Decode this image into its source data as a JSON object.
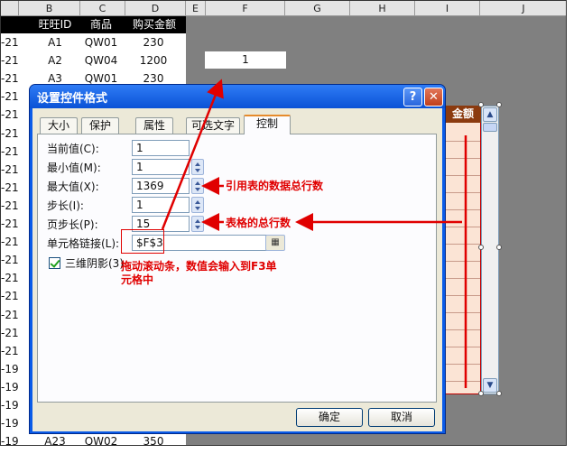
{
  "sheet": {
    "columns": [
      "B",
      "C",
      "D",
      "E",
      "F",
      "G",
      "H",
      "I",
      "J"
    ],
    "table_headers": [
      "旺旺ID",
      "商品",
      "购买金额"
    ],
    "rows": [
      {
        "a": "-21",
        "id": "A1",
        "item": "QW01",
        "amount": "230"
      },
      {
        "a": "-21",
        "id": "A2",
        "item": "QW04",
        "amount": "1200"
      },
      {
        "a": "-21",
        "id": "A3",
        "item": "QW01",
        "amount": "230"
      },
      {
        "a": "-21",
        "id": "",
        "item": "",
        "amount": ""
      },
      {
        "a": "-21",
        "id": "",
        "item": "",
        "amount": ""
      },
      {
        "a": "-21",
        "id": "",
        "item": "",
        "amount": ""
      },
      {
        "a": "-21",
        "id": "",
        "item": "",
        "amount": ""
      },
      {
        "a": "-21",
        "id": "",
        "item": "",
        "amount": ""
      },
      {
        "a": "-21",
        "id": "",
        "item": "",
        "amount": ""
      },
      {
        "a": "-21",
        "id": "",
        "item": "",
        "amount": ""
      },
      {
        "a": "-21",
        "id": "",
        "item": "",
        "amount": ""
      },
      {
        "a": "-21",
        "id": "",
        "item": "",
        "amount": ""
      },
      {
        "a": "-21",
        "id": "",
        "item": "",
        "amount": ""
      },
      {
        "a": "-21",
        "id": "",
        "item": "",
        "amount": ""
      },
      {
        "a": "-21",
        "id": "",
        "item": "",
        "amount": ""
      },
      {
        "a": "-21",
        "id": "",
        "item": "",
        "amount": ""
      },
      {
        "a": "-21",
        "id": "",
        "item": "",
        "amount": ""
      },
      {
        "a": "-21",
        "id": "",
        "item": "",
        "amount": ""
      },
      {
        "a": "-19",
        "id": "",
        "item": "",
        "amount": ""
      },
      {
        "a": "-19",
        "id": "",
        "item": "",
        "amount": ""
      },
      {
        "a": "-19",
        "id": "",
        "item": "",
        "amount": ""
      },
      {
        "a": "-19",
        "id": "",
        "item": "",
        "amount": ""
      },
      {
        "a": "-19",
        "id": "A23",
        "item": "QW02",
        "amount": "350"
      }
    ],
    "f3_value": "1",
    "right_header": "金额"
  },
  "dialog": {
    "title": "设置控件格式",
    "help_glyph": "?",
    "close_glyph": "✕",
    "tabs": [
      "大小",
      "保护",
      "属性",
      "可选文字",
      "控制"
    ],
    "fields": {
      "current_label": "当前值(C):",
      "current_value": "1",
      "min_label": "最小值(M):",
      "min_value": "1",
      "max_label": "最大值(X):",
      "max_value": "1369",
      "step_label": "步长(I):",
      "step_value": "1",
      "page_label": "页步长(P):",
      "page_value": "15",
      "link_label": "单元格链接(L):",
      "link_value": "$F$3",
      "shading_label": "三维阴影(3)",
      "ok_label": "确定",
      "cancel_label": "取消"
    }
  },
  "annotations": {
    "max_note": "引用表的数据总行数",
    "page_note": "表格的总行数",
    "link_note_1": "拖动滚动条，数值会输入到F3单",
    "link_note_2": "元格中"
  },
  "colors": {
    "annotation": "#e00000",
    "dialog_title": "#0a52d6",
    "table_header": "#000000"
  }
}
